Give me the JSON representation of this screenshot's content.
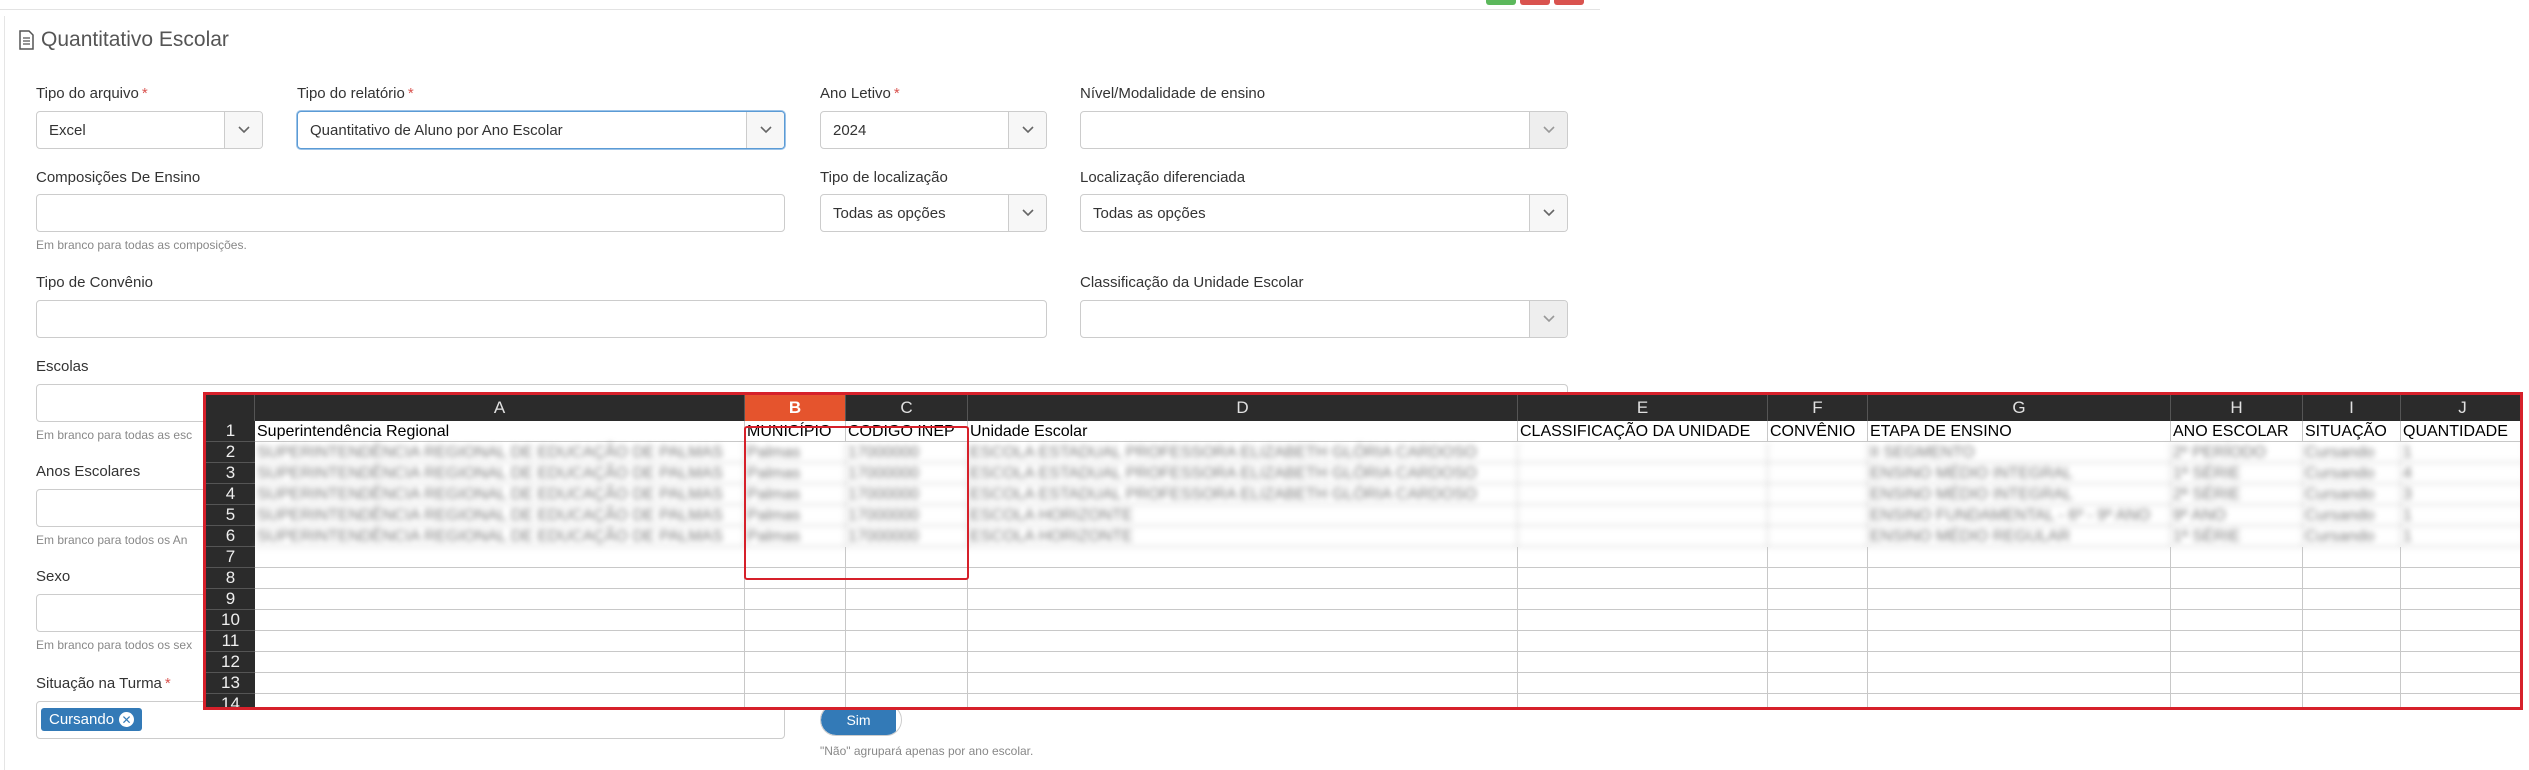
{
  "form": {
    "title": "Quantitativo Escolar",
    "tipo_arquivo": {
      "label": "Tipo do arquivo",
      "value": "Excel"
    },
    "tipo_relatorio": {
      "label": "Tipo do relatório",
      "value": "Quantitativo de Aluno por Ano Escolar"
    },
    "ano_letivo": {
      "label": "Ano Letivo",
      "value": "2024"
    },
    "nivel_modalidade": {
      "label": "Nível/Modalidade de ensino",
      "value": ""
    },
    "composicoes": {
      "label": "Composições De Ensino",
      "help": "Em branco para todas as composições."
    },
    "tipo_localizacao": {
      "label": "Tipo de localização",
      "value": "Todas as opções"
    },
    "localizacao_diferenciada": {
      "label": "Localização diferenciada",
      "value": "Todas as opções"
    },
    "tipo_convenio": {
      "label": "Tipo de Convênio"
    },
    "classificacao_unidade": {
      "label": "Classificação da Unidade Escolar"
    },
    "escolas": {
      "label": "Escolas",
      "help": "Em branco para todas as esc"
    },
    "anos_escolares": {
      "label": "Anos Escolares",
      "help": "Em branco para todos os An"
    },
    "sexo": {
      "label": "Sexo",
      "help": "Em branco para todos os sex"
    },
    "situacao_turma": {
      "label": "Situação na Turma",
      "tag": "Cursando"
    },
    "agrupar": {
      "toggle": "Sim",
      "help": "\"Não\" agrupará apenas por ano escolar."
    }
  },
  "sheet": {
    "columns": [
      "A",
      "B",
      "C",
      "D",
      "E",
      "F",
      "G",
      "H",
      "I",
      "J"
    ],
    "selected_column": "B",
    "row_numbers": [
      "1",
      "2",
      "3",
      "4",
      "5",
      "6",
      "7",
      "8",
      "9",
      "10",
      "11",
      "12",
      "13",
      "14"
    ],
    "headers": [
      "Superintendência Regional",
      "MUNICÍPIO",
      "CODIGO INEP",
      "Unidade Escolar",
      "CLASSIFICAÇÃO DA UNIDADE",
      "CONVÊNIO",
      "ETAPA DE ENSINO",
      "ANO ESCOLAR",
      "SITUAÇÃO",
      "QUANTIDADE"
    ],
    "rows": [
      [
        "SUPERINTENDÊNCIA REGIONAL DE EDUCAÇÃO DE PALMAS",
        "Palmas",
        "17000000",
        "ESCOLA ESTADUAL PROFESSORA ELIZABETH GLÓRIA CARDOSO",
        "",
        "",
        "II SEGMENTO",
        "2º PERÍODO",
        "Cursando",
        "1"
      ],
      [
        "SUPERINTENDÊNCIA REGIONAL DE EDUCAÇÃO DE PALMAS",
        "Palmas",
        "17000000",
        "ESCOLA ESTADUAL PROFESSORA ELIZABETH GLÓRIA CARDOSO",
        "",
        "",
        "ENSINO MÉDIO INTEGRAL",
        "1ª SÉRIE",
        "Cursando",
        "4"
      ],
      [
        "SUPERINTENDÊNCIA REGIONAL DE EDUCAÇÃO DE PALMAS",
        "Palmas",
        "17000000",
        "ESCOLA ESTADUAL PROFESSORA ELIZABETH GLÓRIA CARDOSO",
        "",
        "",
        "ENSINO MÉDIO INTEGRAL",
        "2ª SÉRIE",
        "Cursando",
        "3"
      ],
      [
        "SUPERINTENDÊNCIA REGIONAL DE EDUCAÇÃO DE PALMAS",
        "Palmas",
        "17000000",
        "ESCOLA HORIZONTE",
        "",
        "",
        "ENSINO FUNDAMENTAL - 6º - 9º ANO",
        "9º ANO",
        "Cursando",
        "1"
      ],
      [
        "SUPERINTENDÊNCIA REGIONAL DE EDUCAÇÃO DE PALMAS",
        "Palmas",
        "17000000",
        "ESCOLA HORIZONTE",
        "",
        "",
        "ENSINO MÉDIO REGULAR",
        "1ª SÉRIE",
        "Cursando",
        "1"
      ]
    ]
  },
  "colors": {
    "accent": "#337ab7",
    "highlight": "#d6202a",
    "selected_column": "#e5542d"
  }
}
